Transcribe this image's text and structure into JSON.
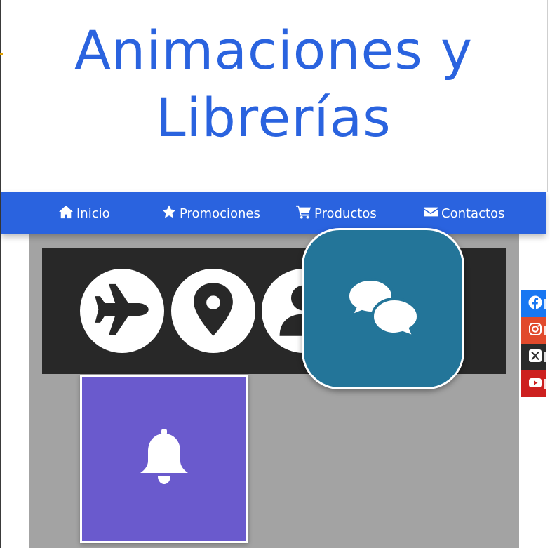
{
  "site": {
    "title": "Animaciones y Librerías"
  },
  "nav": {
    "items": [
      {
        "label": "Inicio",
        "icon": "home-icon"
      },
      {
        "label": "Promociones",
        "icon": "star-icon"
      },
      {
        "label": "Productos",
        "icon": "cart-icon"
      },
      {
        "label": "Contactos",
        "icon": "envelope-icon"
      }
    ]
  },
  "gallery": {
    "circle_icons": [
      "plane-icon",
      "map-marker-icon",
      "user-icon"
    ],
    "chat_icon": "comments-icon",
    "bell_icon": "bell-icon"
  },
  "social": [
    {
      "name": "facebook-icon",
      "color": "#1877f2"
    },
    {
      "name": "instagram-icon",
      "color": "#e4405f"
    },
    {
      "name": "x-icon",
      "color": "#2b2b2b"
    },
    {
      "name": "youtube-icon",
      "color": "#cd201f"
    }
  ],
  "colors": {
    "primary": "#2a63df",
    "main_bg": "#a3a3a3",
    "dark_panel": "#282828",
    "chat_tile": "#237599",
    "bell_tile": "#6a5acd"
  }
}
